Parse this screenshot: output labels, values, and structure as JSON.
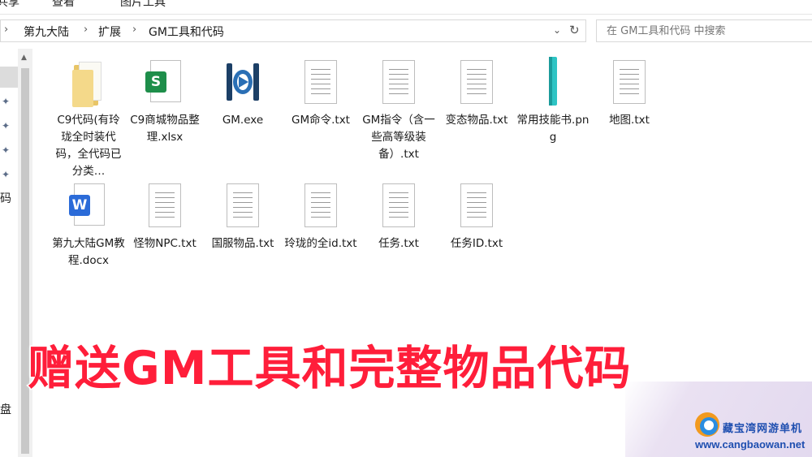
{
  "ribbon": {
    "tabs": [
      "共享",
      "查看",
      "图片工具"
    ]
  },
  "address": {
    "crumbs": [
      "第九大陆",
      "扩展",
      "GM工具和代码"
    ],
    "separator": "›",
    "dropdown_icon": "chevron-down-icon",
    "refresh_icon": "refresh-icon"
  },
  "search": {
    "placeholder": "在 GM工具和代码 中搜索"
  },
  "nav": {
    "partial_labels": [
      "码",
      "盘"
    ]
  },
  "files": [
    {
      "name": "C9代码(有玲珑全时装代码，全代码已分类…",
      "type": "folder"
    },
    {
      "name": "C9商城物品整理.xlsx",
      "type": "xlsx",
      "badge": "S"
    },
    {
      "name": "GM.exe",
      "type": "exe"
    },
    {
      "name": "GM命令.txt",
      "type": "txt"
    },
    {
      "name": "GM指令（含一些高等级装备）.txt",
      "type": "txt"
    },
    {
      "name": "变态物品.txt",
      "type": "txt"
    },
    {
      "name": "常用技能书.png",
      "type": "png"
    },
    {
      "name": "地图.txt",
      "type": "txt"
    },
    {
      "name": "第九大陆GM教程.docx",
      "type": "docx",
      "badge": "W"
    },
    {
      "name": "怪物NPC.txt",
      "type": "txt"
    },
    {
      "name": "国服物品.txt",
      "type": "txt"
    },
    {
      "name": "玲珑的全id.txt",
      "type": "txt"
    },
    {
      "name": "任务.txt",
      "type": "txt"
    },
    {
      "name": "任务ID.txt",
      "type": "txt"
    }
  ],
  "overlay": {
    "banner": "赠送GM工具和完整物品代码"
  },
  "watermark": {
    "title": "藏宝湾网游单机",
    "url": "www.cangbaowan.net"
  }
}
